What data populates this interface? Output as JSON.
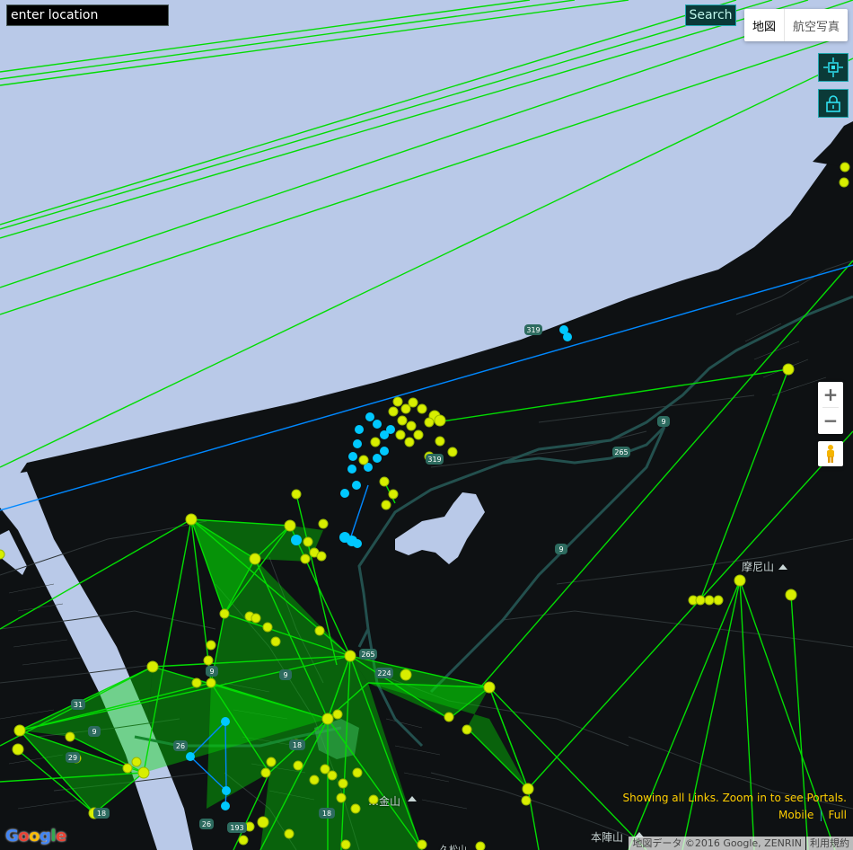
{
  "search": {
    "placeholder": "enter location",
    "button_label": "Search"
  },
  "map_type": {
    "map_label": "地図",
    "satellite_label": "航空写真",
    "selected": "map"
  },
  "side_buttons": [
    {
      "icon": "locate-icon"
    },
    {
      "icon": "lock-icon"
    }
  ],
  "zoom": {
    "in_label": "+",
    "out_label": "−"
  },
  "status": {
    "message": "Showing all Links. Zoom in to see Portals.",
    "mobile_label": "Mobile",
    "full_label": "Full"
  },
  "attribution": {
    "data_text": "地図データ ©2016 Google, ZENRIN",
    "terms_label": "利用規約",
    "google": "Google"
  },
  "place_labels": {
    "maniyama": "摩尼山",
    "kanezan": "…金山",
    "honjinyama": "本陣山",
    "bottom": "久松山"
  },
  "road_shields": [
    "319",
    "9",
    "265",
    "319",
    "9",
    "265",
    "224",
    "9",
    "9",
    "26",
    "18",
    "26",
    "193",
    "29",
    "31",
    "9",
    "18",
    "18"
  ],
  "colors": {
    "sea": "#b9c9e8",
    "land": "#0e1113",
    "river": "#b9c9e8",
    "enlightened": "#03dc03",
    "resistance": "#0088ff",
    "portal_neutral": "#e6f000",
    "portal_resistance": "#00c8ff",
    "ui_accent": "#20a8b1",
    "ui_text": "#ffce00"
  }
}
